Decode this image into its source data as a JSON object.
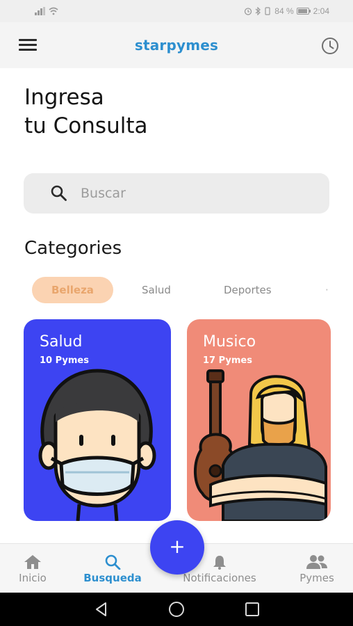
{
  "status_bar": {
    "battery": "84 %",
    "time": "2:04"
  },
  "app_bar": {
    "title": "starpymes"
  },
  "heading": {
    "line1": "Ingresa",
    "line2": "tu Consulta"
  },
  "search": {
    "placeholder": "Buscar",
    "value": ""
  },
  "categories": {
    "title": "Categories",
    "chips": [
      {
        "label": "Belleza",
        "active": true
      },
      {
        "label": "Salud",
        "active": false
      },
      {
        "label": "Deportes",
        "active": false
      },
      {
        "label": "·",
        "active": false
      }
    ]
  },
  "cards": [
    {
      "title": "Salud",
      "count": "10 Pymes",
      "color": "#3d44f2",
      "icon": "masked-person-illustration"
    },
    {
      "title": "Musico",
      "count": "17 Pymes",
      "color": "#f08b78",
      "icon": "guitarist-illustration"
    }
  ],
  "fab": {
    "label": "+"
  },
  "bottom_nav": {
    "items": [
      {
        "label": "Inicio",
        "icon": "home-icon",
        "active": false
      },
      {
        "label": "Busqueda",
        "icon": "search-icon",
        "active": true
      },
      {
        "label": "Notificaciones",
        "icon": "bell-icon",
        "active": false
      },
      {
        "label": "Pymes",
        "icon": "people-icon",
        "active": false
      }
    ]
  },
  "colors": {
    "brand": "#2d8fcf",
    "primary": "#3d44f2",
    "chip_active_bg": "#fbd3b2",
    "chip_active_text": "#e9a66d",
    "musico_card": "#f08b78"
  }
}
